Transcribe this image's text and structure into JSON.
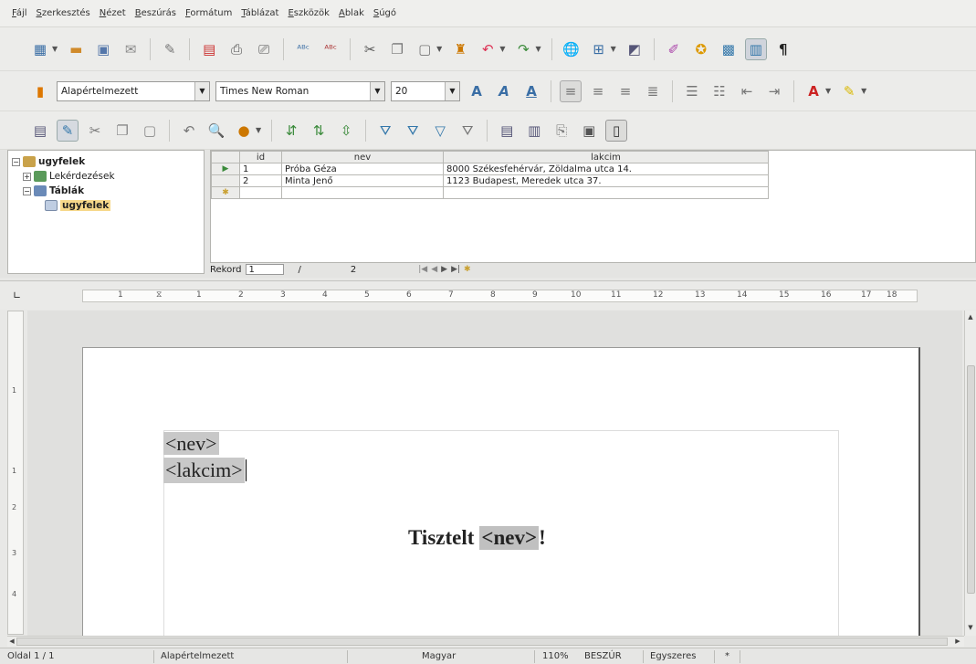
{
  "menu": [
    "Fájl",
    "Szerkesztés",
    "Nézet",
    "Beszúrás",
    "Formátum",
    "Táblázat",
    "Eszközök",
    "Ablak",
    "Súgó"
  ],
  "format_bar": {
    "style": "Alapértelmezett",
    "font": "Times New Roman",
    "size": "20"
  },
  "tree": {
    "root": "ugyfelek",
    "queries": "Lekérdezések",
    "tables": "Táblák",
    "table_item": "ugyfelek"
  },
  "grid": {
    "headers": [
      "id",
      "nev",
      "lakcim"
    ],
    "rows": [
      [
        "1",
        "Próba Géza",
        "8000 Székesfehérvár, Zöldalma utca 14."
      ],
      [
        "2",
        "Minta Jenő",
        "1123 Budapest, Meredek utca 37."
      ]
    ]
  },
  "record_nav": {
    "label": "Rekord",
    "current": "1",
    "of": "/",
    "total": "2"
  },
  "ruler_ticks": [
    "1",
    "1",
    "2",
    "3",
    "4",
    "5",
    "6",
    "7",
    "8",
    "9",
    "10",
    "11",
    "12",
    "13",
    "14",
    "15",
    "16",
    "17",
    "18"
  ],
  "document": {
    "field1": "<nev>",
    "field2": "<lakcim>",
    "greeting_prefix": "Tisztelt",
    "greeting_field": "<nev>",
    "greeting_suffix": "!"
  },
  "status": {
    "page": "Oldal 1 / 1",
    "style": "Alapértelmezett",
    "language": "Magyar",
    "zoom": "110%",
    "mode": "BESZÚR",
    "selection": "Egyszeres",
    "modified": "*"
  }
}
